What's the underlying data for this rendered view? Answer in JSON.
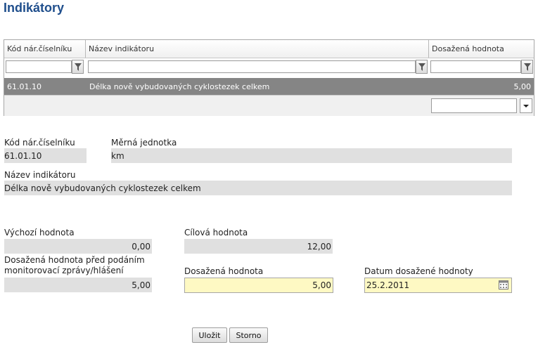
{
  "page": {
    "title": "Indikátory"
  },
  "grid": {
    "columns": [
      "Kód nár.číselníku",
      "Název indikátoru",
      "Dosažená hodnota"
    ],
    "rows": [
      {
        "code": "61.01.10",
        "name": "Délka nově vybudovaných cyklostezek celkem",
        "value": "5,00"
      }
    ],
    "pager_value": ""
  },
  "detail": {
    "code_label": "Kód nár.číselníku",
    "code_value": "61.01.10",
    "unit_label": "Měrná jednotka",
    "unit_value": "km",
    "name_label": "Název indikátoru",
    "name_value": "Délka nově vybudovaných cyklostezek celkem",
    "initial_label": "Výchozí hodnota",
    "initial_value": "0,00",
    "target_label": "Cílová hodnota",
    "target_value": "12,00",
    "before_label_1": "Dosažená hodnota před podáním",
    "before_label_2": "monitorovací zprávy/hlášení",
    "before_value": "5,00",
    "achieved_label": "Dosažená hodnota",
    "achieved_value": "5,00",
    "date_label": "Datum dosažené hodnoty",
    "date_value": "25.2.2011"
  },
  "buttons": {
    "save": "Uložit",
    "cancel": "Storno"
  },
  "colors": {
    "title": "#1f4e8c",
    "selected_row": "#858585",
    "editable_bg": "#fef9c3",
    "readonly_bg": "#e0e0e0"
  }
}
